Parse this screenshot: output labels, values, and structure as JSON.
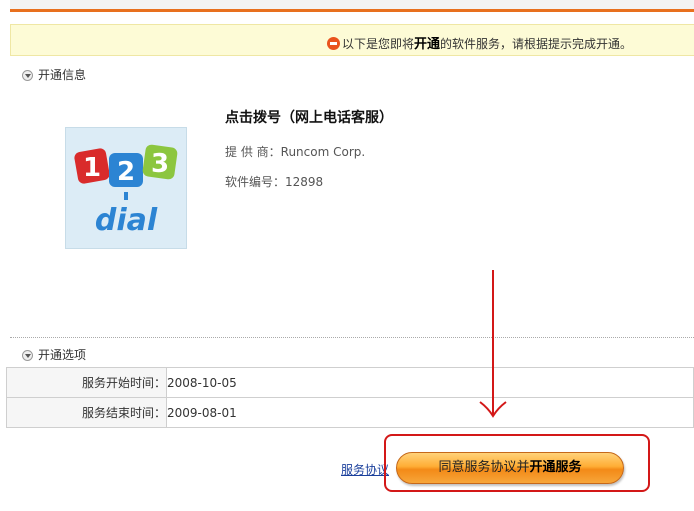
{
  "notice": {
    "prefix": "以下是您即将",
    "emphasis": "开通",
    "suffix": "的软件服务，请根据提示完成开通。",
    "icon": "minus-circle-icon"
  },
  "sections": {
    "info_title": "开通信息",
    "options_title": "开通选项"
  },
  "software": {
    "name": "点击拨号（网上电话客服）",
    "provider_label": "提 供 商：",
    "provider_value": "Runcom Corp.",
    "id_label": "软件编号：",
    "id_value": "12898",
    "logo": {
      "digits": [
        "1",
        "2",
        "3"
      ],
      "word": "dial",
      "digit_colors": [
        "#d92b2b",
        "#2c84d3",
        "#8cc63f"
      ]
    }
  },
  "options": [
    {
      "label": "服务开始时间：",
      "value": "2008-10-05"
    },
    {
      "label": "服务结束时间：",
      "value": "2009-08-01"
    }
  ],
  "actions": {
    "agreement_link": "服务协议",
    "button_prefix": "同意服务协议并",
    "button_emphasis": "开通服务"
  },
  "colors": {
    "accent": "#e8701e",
    "annotation_red": "#d31818",
    "button_orange": "#f38a17"
  }
}
